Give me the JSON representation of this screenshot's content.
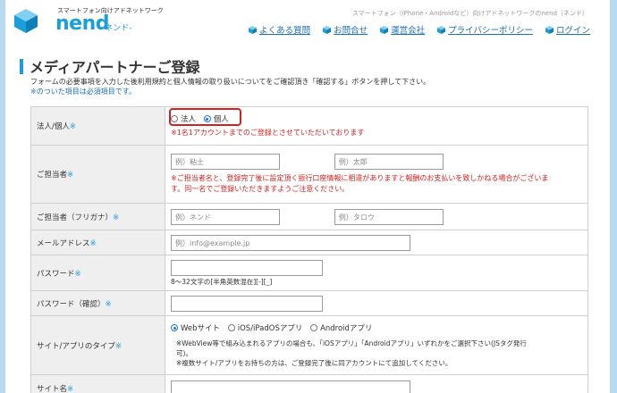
{
  "header": {
    "tagline": "スマートフォン向けアドネットワーク",
    "logo_word": "nend",
    "logo_kana": "-ネンド-",
    "site_description": "スマートフォン（iPhone・Androidなど）向けアドネットワークのnend（ネンド）",
    "nav": [
      {
        "label": "よくある質問",
        "icon": "cube-icon"
      },
      {
        "label": "お問合せ",
        "icon": "cube-icon"
      },
      {
        "label": "運営会社",
        "icon": "cube-icon"
      },
      {
        "label": "プライバシーポリシー",
        "icon": "cube-icon"
      },
      {
        "label": "ログイン",
        "icon": "cube-icon"
      }
    ]
  },
  "page": {
    "title": "メディアパートナーご登録",
    "intro": "フォームの必要事項を入力した後利用規約と個人情報の取り扱いについてをご確認頂き「確認する」ボタンを押して下さい。",
    "required_note": "※のついた項目は必須項目です。"
  },
  "form": {
    "required_mark": "※",
    "entity": {
      "label": "法人/個人",
      "options": [
        "法人",
        "個人"
      ],
      "selected": "個人",
      "warning": "※1名1アカウントまでのご登録とさせていただいております"
    },
    "contact_name": {
      "label": "ご担当者",
      "last_placeholder": "例）粘土",
      "first_placeholder": "例）太郎",
      "warning_line1": "※ご担当者名と、登録完了後に設定頂く振行口座情報に相違がありますと報酬のお支払いを致しかねる場合がございま",
      "warning_line2": "す。同一名でご登録いただきますようご注意ください。"
    },
    "contact_kana": {
      "label": "ご担当者（フリガナ）",
      "last_placeholder": "例）ネンド",
      "first_placeholder": "例）タロウ"
    },
    "email": {
      "label": "メールアドレス",
      "placeholder": "例）info@example.jp"
    },
    "password": {
      "label": "パスワード",
      "value": "",
      "hint": "8～32文字の[半角英数混在][-][_]"
    },
    "password_confirm": {
      "label": "パスワード（確認）",
      "value": ""
    },
    "site_type": {
      "label": "サイト/アプリのタイプ",
      "options": [
        "Webサイト",
        "iOS/iPadOSアプリ",
        "Androidアプリ"
      ],
      "selected": "Webサイト",
      "note_line1": "※WebView等で組み込まれるアプリの場合も、「iOSアプリ」「Androidアプリ」いずれかをご選択下さい(JSタグ発行",
      "note_line2": "可)。",
      "note_line3": "※複数サイト/アプリをお持ちの方は、ご登録完了後に同アカウントにて追加してください。"
    },
    "site_name": {
      "label": "サイト名",
      "value": ""
    }
  },
  "colors": {
    "accent": "#1a9fd9",
    "link": "#1a6fb5",
    "warning": "#d62020",
    "background": "#b9dbf0"
  }
}
